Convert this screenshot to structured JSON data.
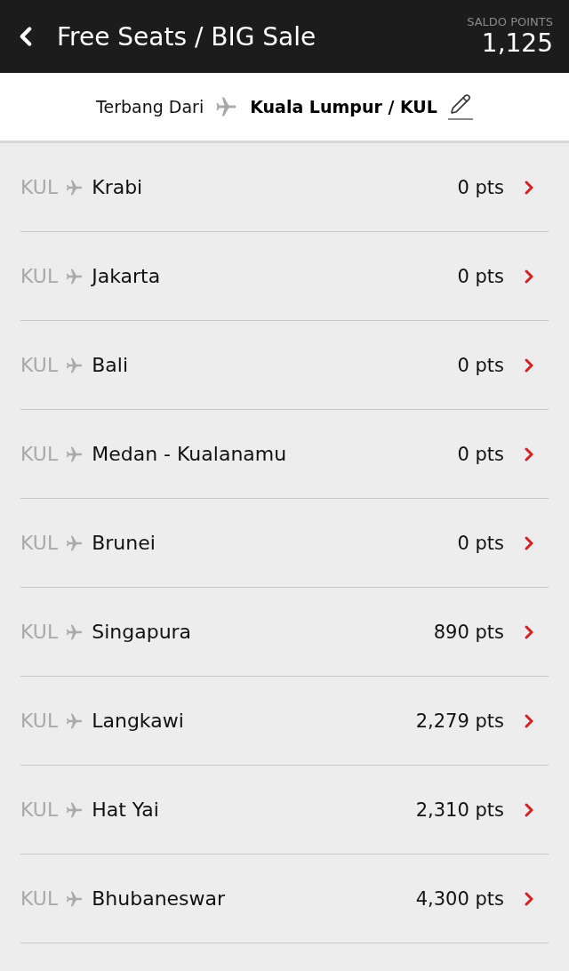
{
  "header": {
    "title": "Free Seats / BIG Sale",
    "points_label": "SALDO POINTS",
    "points_value": "1,125"
  },
  "origin": {
    "label": "Terbang Dari",
    "city": "Kuala Lumpur / KUL"
  },
  "routes": [
    {
      "from": "KUL",
      "destination": "Krabi",
      "points": "0 pts"
    },
    {
      "from": "KUL",
      "destination": "Jakarta",
      "points": "0 pts"
    },
    {
      "from": "KUL",
      "destination": "Bali",
      "points": "0 pts"
    },
    {
      "from": "KUL",
      "destination": "Medan - Kualanamu",
      "points": "0 pts"
    },
    {
      "from": "KUL",
      "destination": "Brunei",
      "points": "0 pts"
    },
    {
      "from": "KUL",
      "destination": "Singapura",
      "points": "890 pts"
    },
    {
      "from": "KUL",
      "destination": "Langkawi",
      "points": "2,279 pts"
    },
    {
      "from": "KUL",
      "destination": "Hat Yai",
      "points": "2,310 pts"
    },
    {
      "from": "KUL",
      "destination": "Bhubaneswar",
      "points": "4,300 pts"
    }
  ]
}
